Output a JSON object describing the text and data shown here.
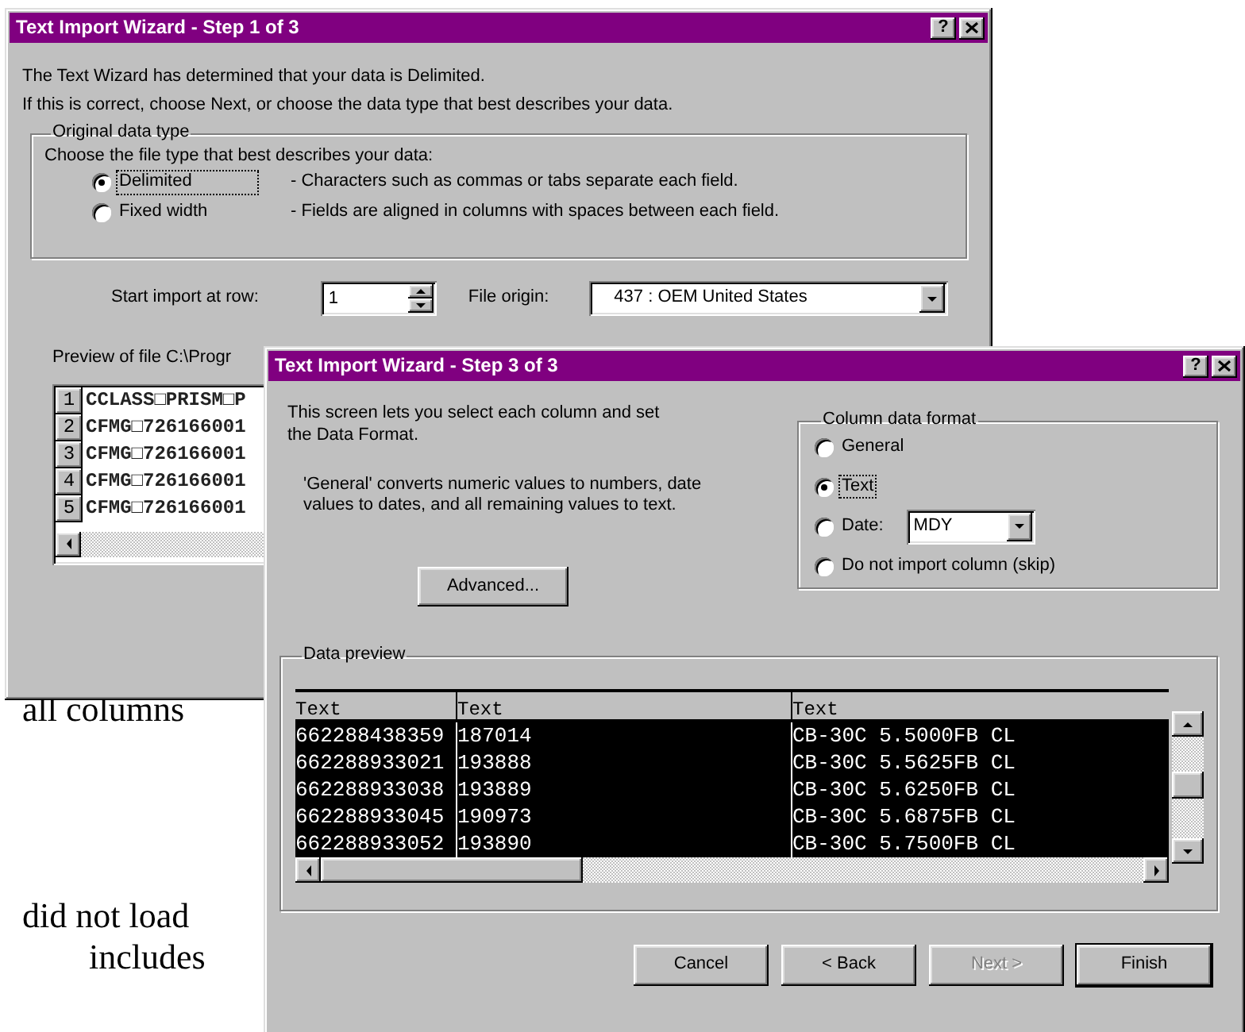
{
  "document_text": [
    {
      "text": "all columns"
    },
    {
      "text": "did not load"
    },
    {
      "text": "includes"
    }
  ],
  "step1_dialog": {
    "title": "Text Import Wizard - Step 1 of 3",
    "help_button": "?",
    "intro": [
      "The Text Wizard has determined that your data is Delimited.",
      "If this is correct, choose Next, or choose the data type that best describes your data."
    ],
    "group": {
      "title": "Original data type",
      "prompt": "Choose the file type that best describes your data:",
      "options": [
        {
          "label": "Delimited",
          "description": "- Characters such as commas or tabs separate each field.",
          "selected": true,
          "focused": true
        },
        {
          "label": "Fixed width",
          "description": "- Fields are aligned in columns with spaces between each field.",
          "selected": false,
          "focused": false
        }
      ]
    },
    "start_row": {
      "label": "Start import at row:",
      "value": "1"
    },
    "file_origin": {
      "label": "File origin:",
      "value": "437 : OEM United States"
    },
    "preview": {
      "label": "Preview of file C:\\Progr",
      "rows": [
        {
          "number": "1",
          "text": "CCLASS□PRISM□P"
        },
        {
          "number": "2",
          "text": "CFMG□726166001"
        },
        {
          "number": "3",
          "text": "CFMG□726166001"
        },
        {
          "number": "4",
          "text": "CFMG□726166001"
        },
        {
          "number": "5",
          "text": "CFMG□726166001"
        }
      ]
    }
  },
  "step3_dialog": {
    "title": "Text Import Wizard - Step 3 of 3",
    "help_button": "?",
    "instructions": [
      "This screen lets you select each column and set the Data Format.",
      "'General' converts numeric values to numbers, date values to dates, and all remaining values to text."
    ],
    "advanced_button": "Advanced...",
    "format_group": {
      "title": "Column data format",
      "options": [
        {
          "kind": "plain",
          "label": "General",
          "selected": false,
          "focused": false
        },
        {
          "kind": "plain",
          "label": "Text",
          "selected": true,
          "focused": true
        },
        {
          "kind": "date",
          "label": "Date:",
          "selected": false,
          "focused": false,
          "date_format": "MDY"
        },
        {
          "kind": "plain",
          "label": "Do not import column (skip)",
          "selected": false,
          "focused": false
        }
      ]
    },
    "data_preview": {
      "title": "Data preview",
      "columns": [
        {
          "header": "Text",
          "selected": true
        },
        {
          "header": "Text",
          "selected": true
        },
        {
          "header": "Text",
          "selected": true
        }
      ],
      "rows": [
        [
          "662288438359",
          "187014",
          "CB-30C 5.5000FB CL"
        ],
        [
          "662288933021",
          "193888",
          "CB-30C 5.5625FB CL"
        ],
        [
          "662288933038",
          "193889",
          "CB-30C 5.6250FB CL"
        ],
        [
          "662288933045",
          "190973",
          "CB-30C 5.6875FB CL"
        ],
        [
          "662288933052",
          "193890",
          "CB-30C 5.7500FB CL"
        ]
      ]
    },
    "buttons": [
      {
        "label": "Cancel",
        "disabled": false,
        "default": false
      },
      {
        "label": "< Back",
        "disabled": false,
        "default": false
      },
      {
        "label": "Next >",
        "disabled": true,
        "default": false
      },
      {
        "label": "Finish",
        "disabled": false,
        "default": true
      }
    ]
  }
}
